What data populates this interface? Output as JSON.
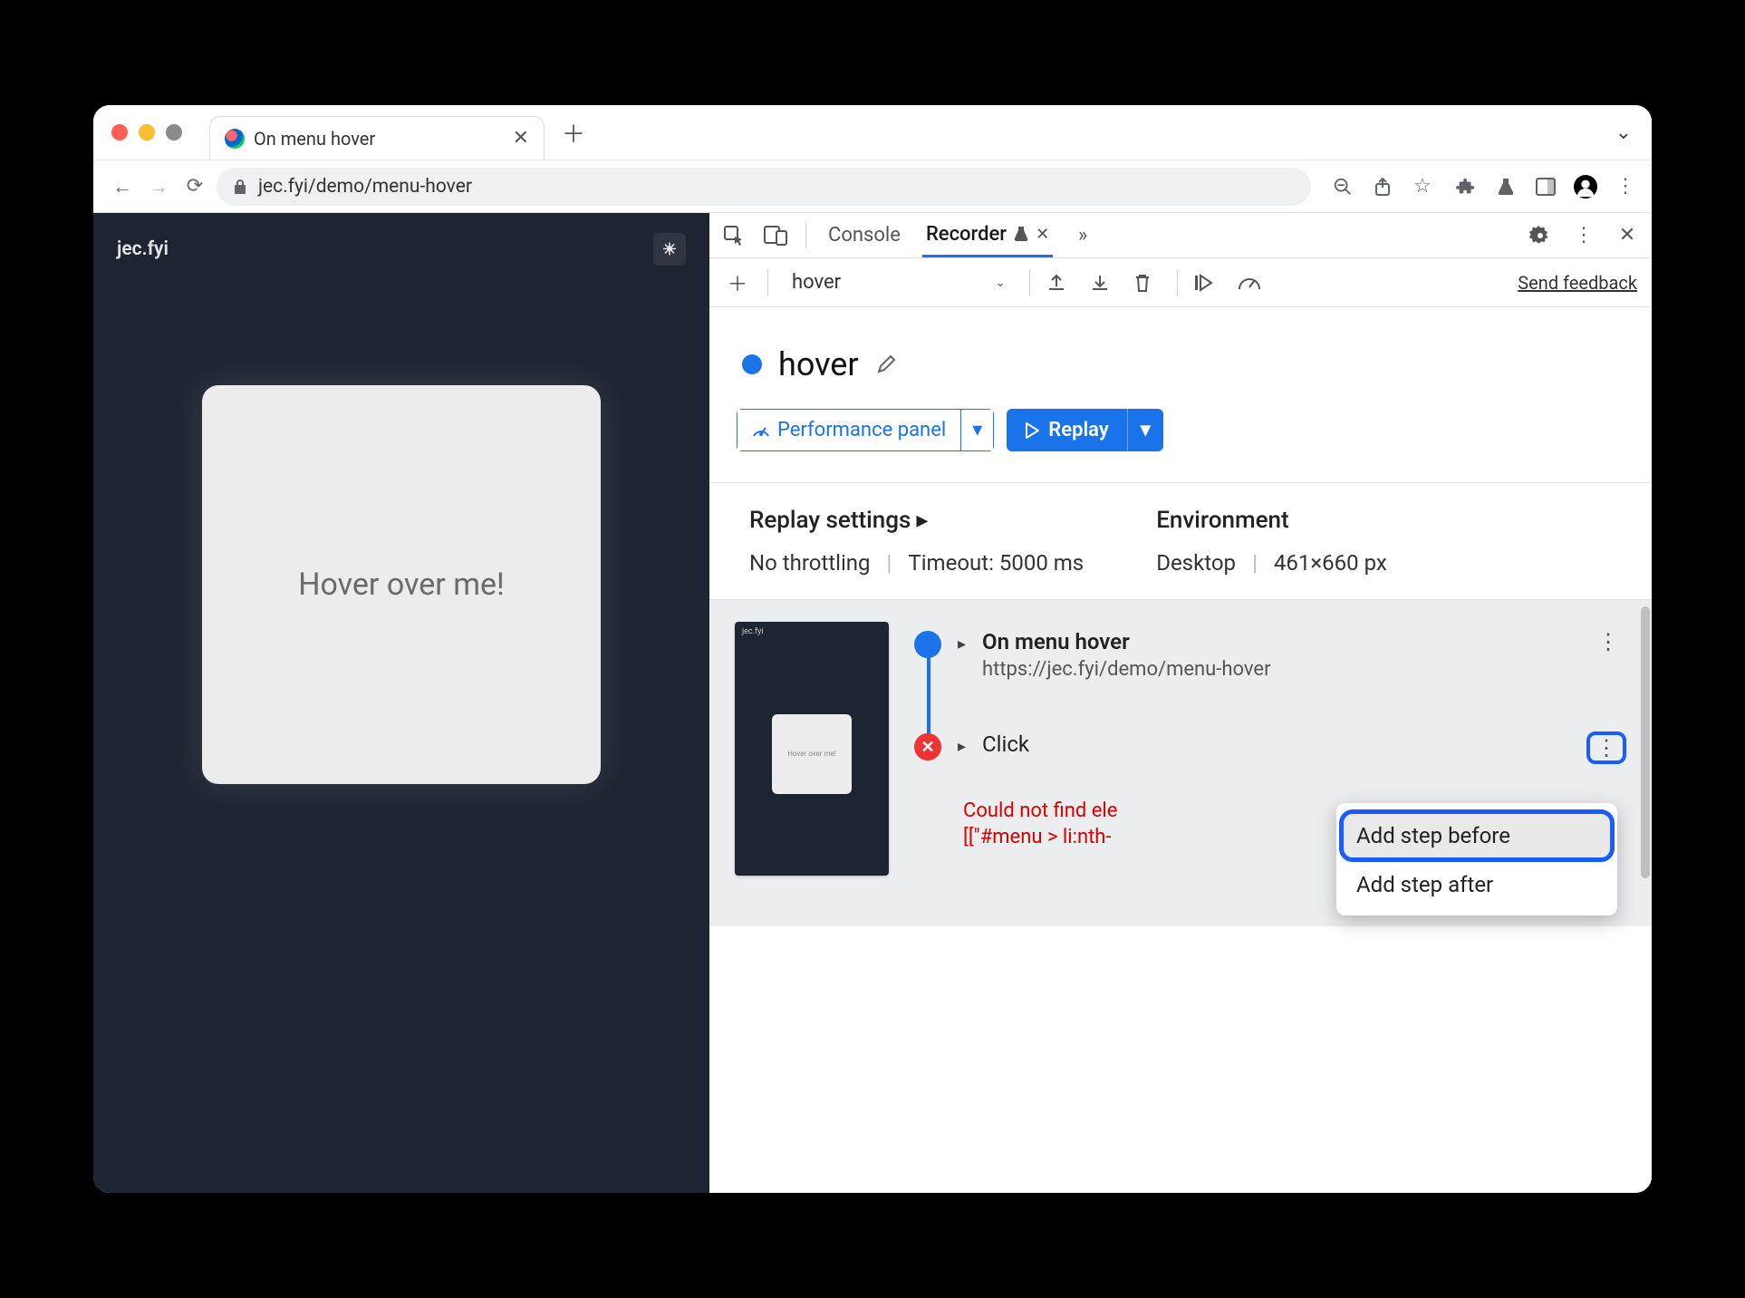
{
  "window": {
    "tab_title": "On menu hover",
    "url": "jec.fyi/demo/menu-hover"
  },
  "page": {
    "brand": "jec.fyi",
    "card_text": "Hover over me!"
  },
  "devtools": {
    "tabs": {
      "console": "Console",
      "recorder": "Recorder"
    },
    "toolbar": {
      "recording_name": "hover",
      "feedback": "Send feedback"
    },
    "title": "hover",
    "buttons": {
      "perf_panel": "Performance panel",
      "replay": "Replay"
    },
    "settings": {
      "replay_heading": "Replay settings",
      "throttling": "No throttling",
      "timeout": "Timeout: 5000 ms",
      "env_heading": "Environment",
      "device": "Desktop",
      "viewport": "461×660 px"
    },
    "steps": {
      "step1_title": "On menu hover",
      "step1_url": "https://jec.fyi/demo/menu-hover",
      "step2_title": "Click",
      "error_line1": "Could not find ele",
      "error_line2": "[[\"#menu > li:nth-"
    },
    "context_menu": {
      "add_before": "Add step before",
      "add_after": "Add step after"
    },
    "thumb": {
      "brand": "jec.fyi",
      "card": "Hover over me!"
    }
  }
}
